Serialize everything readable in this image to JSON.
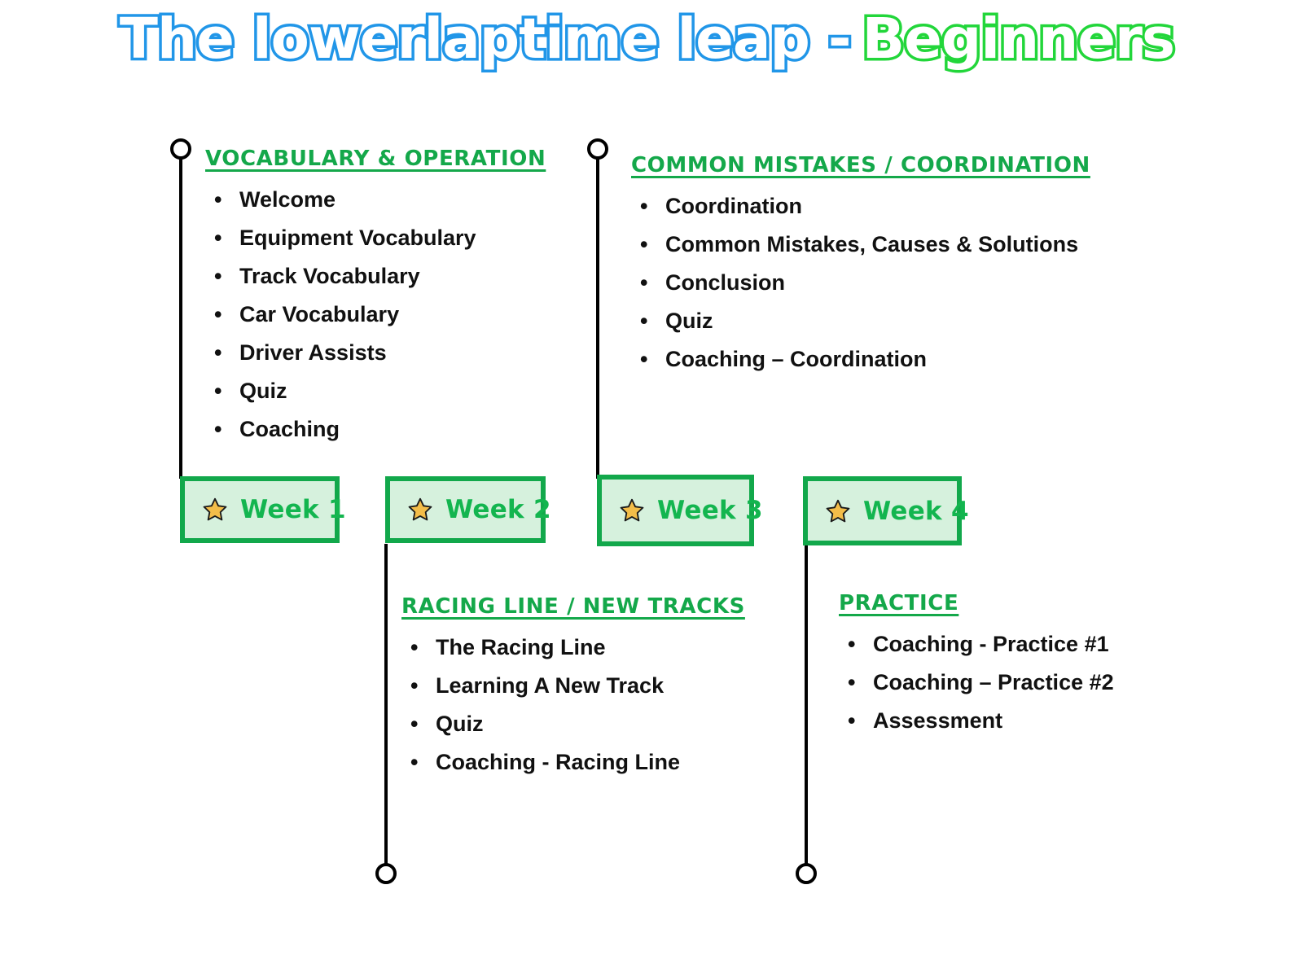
{
  "title": {
    "part1": "The lowerlaptime leap -",
    "part2": "Beginners",
    "color_part1": "#2196e8",
    "color_part2": "#22d63a"
  },
  "theme": {
    "green_heading": "#14a84a",
    "box_border": "#12a84b",
    "box_fill": "#d6f1dd",
    "week_label": "#13b54f",
    "star": "#f3bd49",
    "line": "#000000",
    "bullet_text": "#111111"
  },
  "sections": [
    {
      "id": "vocabulary-operation",
      "heading": "VOCABULARY & OPERATION",
      "items": [
        "Welcome",
        "Equipment Vocabulary",
        "Track Vocabulary",
        "Car Vocabulary",
        "Driver Assists",
        "Quiz",
        "Coaching"
      ]
    },
    {
      "id": "common-mistakes-coordination",
      "heading": "COMMON MISTAKES / COORDINATION",
      "items": [
        "Coordination",
        "Common Mistakes, Causes & Solutions",
        "Conclusion",
        "Quiz",
        "Coaching – Coordination"
      ]
    },
    {
      "id": "racing-line-new-tracks",
      "heading": "RACING LINE / NEW TRACKS",
      "items": [
        "The Racing Line",
        "Learning A New Track",
        "Quiz",
        "Coaching - Racing Line"
      ]
    },
    {
      "id": "practice",
      "heading": "PRACTICE",
      "items": [
        "Coaching  - Practice #1",
        "Coaching – Practice #2",
        "Assessment"
      ]
    }
  ],
  "weeks": [
    {
      "id": "week-1",
      "label": "Week 1",
      "icon": "star-icon"
    },
    {
      "id": "week-2",
      "label": "Week 2",
      "icon": "star-icon"
    },
    {
      "id": "week-3",
      "label": "Week 3",
      "icon": "star-icon"
    },
    {
      "id": "week-4",
      "label": "Week 4",
      "icon": "star-icon"
    }
  ]
}
